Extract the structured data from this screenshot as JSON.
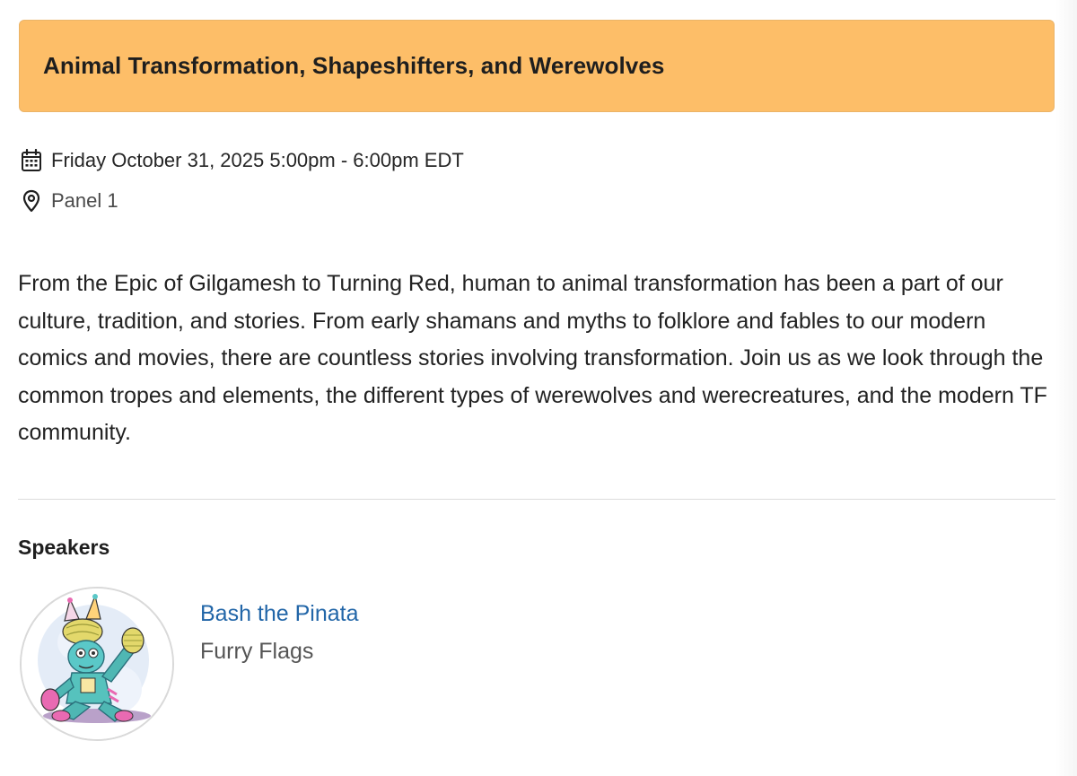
{
  "event": {
    "title": "Animal Transformation, Shapeshifters, and Werewolves",
    "datetime": "Friday October 31, 2025 5:00pm - 6:00pm EDT",
    "location": "Panel 1",
    "description": "From the Epic of Gilgamesh to Turning Red, human to animal transformation has been a part of our culture, tradition, and stories. From early shamans and myths to folklore and fables to our modern comics and movies, there are countless stories involving transformation. Join us as we look through the common tropes and elements, the different types of werewolves and werecreatures, and the modern TF community."
  },
  "speakers": {
    "heading": "Speakers",
    "items": [
      {
        "name": "Bash the Pinata",
        "organization": "Furry Flags",
        "avatar_icon": "pinata-character-avatar"
      }
    ]
  },
  "icons": {
    "date": "calendar-icon",
    "location": "map-pin-icon"
  },
  "colors": {
    "title_bar": "#fdbe68",
    "link": "#2266a8",
    "divider": "#dcdcdc"
  }
}
